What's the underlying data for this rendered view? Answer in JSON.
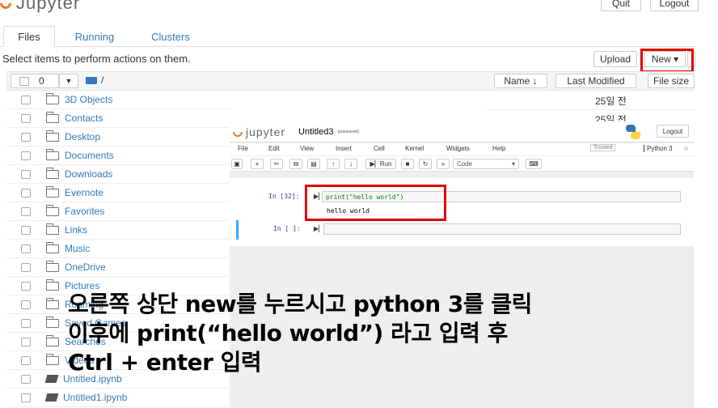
{
  "header": {
    "logo_text": "Jupyter",
    "quit_label": "Quit",
    "logout_label": "Logout"
  },
  "tabs": [
    {
      "label": "Files"
    },
    {
      "label": "Running"
    },
    {
      "label": "Clusters"
    }
  ],
  "hint": "Select items to perform actions on them.",
  "actions": {
    "upload_label": "Upload",
    "new_label": "New ▾"
  },
  "list_header": {
    "count": "0",
    "path": "/",
    "name_col": "Name ↓",
    "modified_col": "Last Modified",
    "size_col": "File size"
  },
  "files": [
    {
      "name": "3D Objects",
      "modified": "25일 전",
      "type": "folder"
    },
    {
      "name": "Contacts",
      "modified": "25일 전",
      "type": "folder"
    },
    {
      "name": "Desktop",
      "type": "folder"
    },
    {
      "name": "Documents",
      "type": "folder"
    },
    {
      "name": "Downloads",
      "type": "folder"
    },
    {
      "name": "Evernote",
      "type": "folder"
    },
    {
      "name": "Favorites",
      "type": "folder"
    },
    {
      "name": "Links",
      "type": "folder"
    },
    {
      "name": "Music",
      "type": "folder"
    },
    {
      "name": "OneDrive",
      "type": "folder"
    },
    {
      "name": "Pictures",
      "type": "folder"
    },
    {
      "name": "Roaming",
      "type": "folder"
    },
    {
      "name": "Saved Games",
      "type": "folder"
    },
    {
      "name": "Searches",
      "type": "folder"
    },
    {
      "name": "Videos",
      "type": "folder"
    },
    {
      "name": "Untitled.ipynb",
      "type": "notebook"
    },
    {
      "name": "Untitled1.ipynb",
      "type": "notebook"
    }
  ],
  "notebook": {
    "logo_text": "jupyter",
    "title": "Untitled3",
    "autosave": "(autosaved)",
    "logout_label": "Logout",
    "menu": [
      "File",
      "Edit",
      "View",
      "Insert",
      "Cell",
      "Kernel",
      "Widgets",
      "Help"
    ],
    "trusted": "Trusted",
    "kernel": "Python 3",
    "toolbar": {
      "run_label": "Run",
      "cell_type": "Code"
    },
    "cell1": {
      "prompt": "In [32]:",
      "code": "print(\"hello world\")",
      "output": "hello world"
    },
    "cell2": {
      "prompt": "In [ ]:"
    }
  },
  "annotation": {
    "line1": "오른쪽 상단 new를 누르시고 python 3를 클릭",
    "line2": "이후에 print(“hello world”) 라고 입력 후",
    "line3": "Ctrl + enter 입력"
  },
  "colors": {
    "jupyter_orange": "#f37726",
    "link": "#337ab7",
    "highlight_red": "#e00000"
  }
}
